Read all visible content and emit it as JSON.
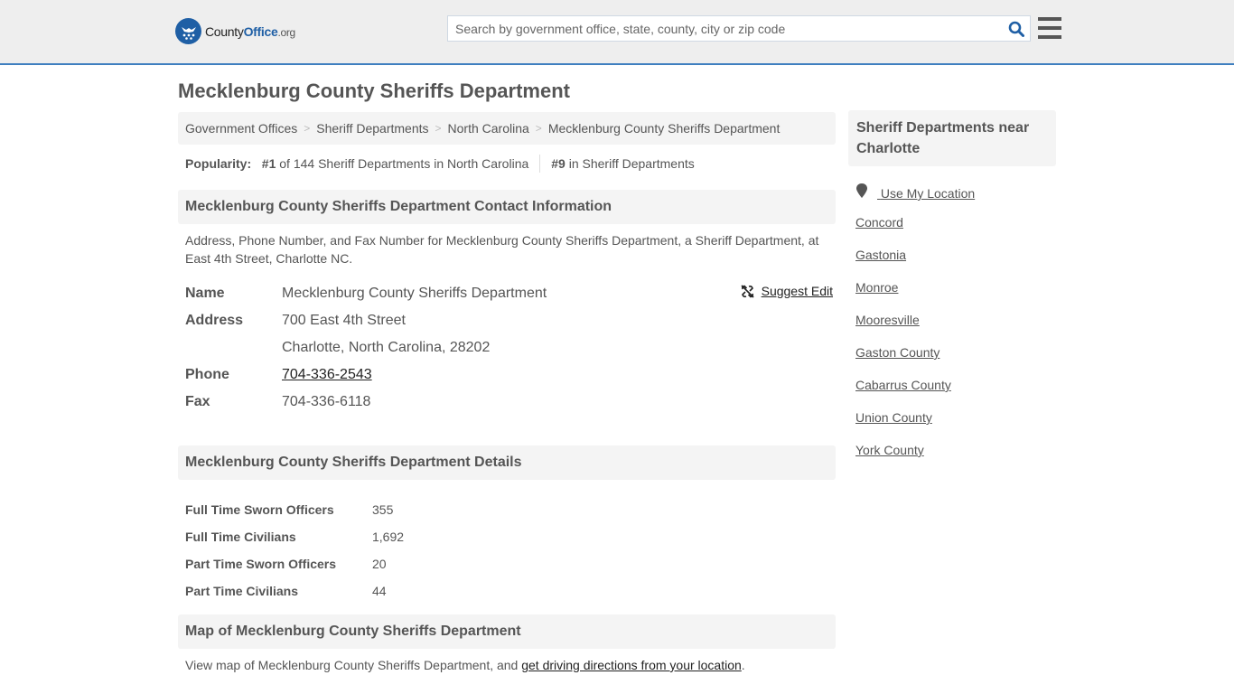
{
  "header": {
    "logo": {
      "name_part1": "County",
      "name_part2": "Office",
      "name_part3": ".org"
    },
    "search": {
      "placeholder": "Search by government office, state, county, city or zip code",
      "value": ""
    },
    "colors": {
      "brand": "#1f5fa5",
      "accent_line": "#3f7fbf"
    }
  },
  "page": {
    "title": "Mecklenburg County Sheriffs Department"
  },
  "breadcrumb": [
    {
      "label": "Government Offices"
    },
    {
      "label": "Sheriff Departments"
    },
    {
      "label": "North Carolina"
    },
    {
      "label": "Mecklenburg County Sheriffs Department"
    }
  ],
  "popularity": {
    "label": "Popularity:",
    "state_rank": "#1",
    "state_text": "of 144 Sheriff Departments in North Carolina",
    "national_rank": "#9",
    "national_text": "in Sheriff Departments"
  },
  "contact": {
    "heading": "Mecklenburg County Sheriffs Department Contact Information",
    "description": "Address, Phone Number, and Fax Number for Mecklenburg County Sheriffs Department, a Sheriff Department, at East 4th Street, Charlotte NC.",
    "suggest_edit": "Suggest Edit",
    "name_label": "Name",
    "name": "Mecklenburg County Sheriffs Department",
    "address_label": "Address",
    "address_line1": "700 East 4th Street",
    "address_line2": "Charlotte, North Carolina, 28202",
    "phone_label": "Phone",
    "phone": "704-336-2543",
    "fax_label": "Fax",
    "fax": "704-336-6118"
  },
  "details": {
    "heading": "Mecklenburg County Sheriffs Department Details",
    "rows": [
      {
        "label": "Full Time Sworn Officers",
        "value": "355"
      },
      {
        "label": "Full Time Civilians",
        "value": "1,692"
      },
      {
        "label": "Part Time Sworn Officers",
        "value": "20"
      },
      {
        "label": "Part Time Civilians",
        "value": "44"
      }
    ]
  },
  "map": {
    "heading": "Map of Mecklenburg County Sheriffs Department",
    "text_before": "View map of Mecklenburg County Sheriffs Department, and ",
    "link": "get driving directions from your location",
    "text_after": "."
  },
  "sidebar": {
    "heading": "Sheriff Departments near Charlotte",
    "use_location": "Use My Location",
    "links": [
      {
        "label": "Concord"
      },
      {
        "label": "Gastonia"
      },
      {
        "label": "Monroe"
      },
      {
        "label": "Mooresville"
      },
      {
        "label": "Gaston County"
      },
      {
        "label": "Cabarrus County"
      },
      {
        "label": "Union County"
      },
      {
        "label": "York County"
      }
    ]
  }
}
